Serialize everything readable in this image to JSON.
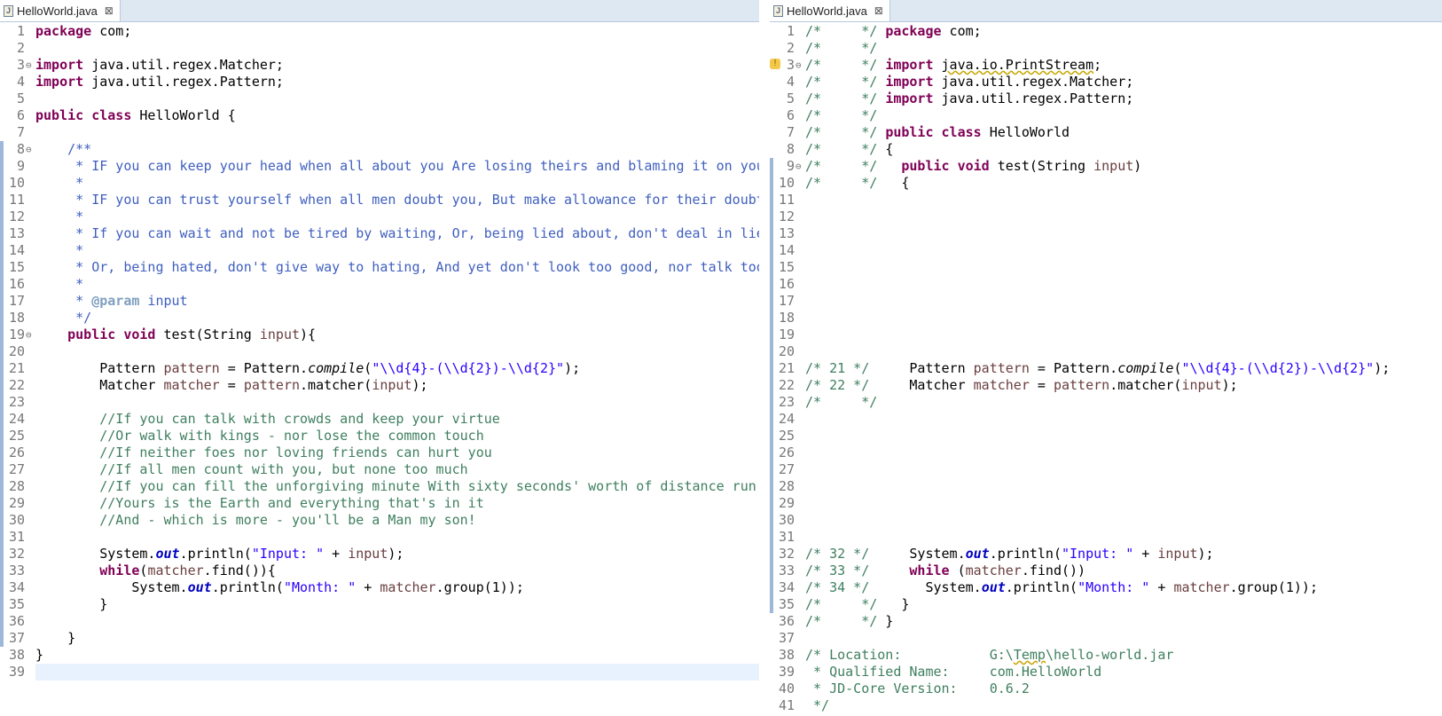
{
  "left": {
    "tab": {
      "label": "HelloWorld.java",
      "close_icon": "close-icon",
      "file_icon": "java-file-icon"
    },
    "lines": [
      {
        "n": "1",
        "html": "<span class=\"kw\">package</span> com;"
      },
      {
        "n": "2",
        "html": ""
      },
      {
        "n": "3",
        "fold": "⊖",
        "html": "<span class=\"kw\">import</span> java.util.regex.Matcher;"
      },
      {
        "n": "4",
        "html": "<span class=\"kw\">import</span> java.util.regex.Pattern;"
      },
      {
        "n": "5",
        "html": ""
      },
      {
        "n": "6",
        "html": "<span class=\"kw\">public</span> <span class=\"kw\">class</span> HelloWorld {"
      },
      {
        "n": "7",
        "html": ""
      },
      {
        "n": "8",
        "fold": "⊖",
        "marker": true,
        "html": "    <span class=\"jd\">/**</span>"
      },
      {
        "n": "9",
        "marker": true,
        "html": "<span class=\"jd\">     * IF you can keep your head when all about you Are losing theirs and blaming it on you</span>"
      },
      {
        "n": "10",
        "marker": true,
        "html": "<span class=\"jd\">     *</span>"
      },
      {
        "n": "11",
        "marker": true,
        "html": "<span class=\"jd\">     * IF you can trust yourself when all men doubt you, But make allowance for their doubting</span>"
      },
      {
        "n": "12",
        "marker": true,
        "html": "<span class=\"jd\">     *</span>"
      },
      {
        "n": "13",
        "marker": true,
        "html": "<span class=\"jd\">     * If you can wait and not be tired by waiting, Or, being lied about, don't deal in lies</span>"
      },
      {
        "n": "14",
        "marker": true,
        "html": "<span class=\"jd\">     *</span>"
      },
      {
        "n": "15",
        "marker": true,
        "html": "<span class=\"jd\">     * Or, being hated, don't give way to hating, And yet don't look too good, nor talk too wise</span>"
      },
      {
        "n": "16",
        "marker": true,
        "html": "<span class=\"jd\">     *</span>"
      },
      {
        "n": "17",
        "marker": true,
        "html": "<span class=\"jd\">     * </span><span class=\"jdtag\">@param</span><span class=\"jd\"> input</span>"
      },
      {
        "n": "18",
        "marker": true,
        "html": "<span class=\"jd\">     */</span>"
      },
      {
        "n": "19",
        "fold": "⊖",
        "marker": true,
        "html": "    <span class=\"kw\">public</span> <span class=\"kw\">void</span> test(String <span class=\"var\">input</span>){"
      },
      {
        "n": "20",
        "marker": true,
        "html": ""
      },
      {
        "n": "21",
        "marker": true,
        "html": "        Pattern <span class=\"var\">pattern</span> = Pattern.<span class=\"ital\">compile</span>(<span class=\"str\">\"\\\\d{4}-(\\\\d{2})-\\\\d{2}\"</span>);"
      },
      {
        "n": "22",
        "marker": true,
        "html": "        Matcher <span class=\"var\">matcher</span> = <span class=\"var\">pattern</span>.matcher(<span class=\"var\">input</span>);"
      },
      {
        "n": "23",
        "marker": true,
        "html": ""
      },
      {
        "n": "24",
        "marker": true,
        "html": "        <span class=\"cmt\">//If you can talk with crowds and keep your virtue</span>"
      },
      {
        "n": "25",
        "marker": true,
        "html": "        <span class=\"cmt\">//Or walk with kings - nor lose the common touch</span>"
      },
      {
        "n": "26",
        "marker": true,
        "html": "        <span class=\"cmt\">//If neither foes nor loving friends can hurt you</span>"
      },
      {
        "n": "27",
        "marker": true,
        "html": "        <span class=\"cmt\">//If all men count with you, but none too much</span>"
      },
      {
        "n": "28",
        "marker": true,
        "html": "        <span class=\"cmt\">//If you can fill the unforgiving minute With sixty seconds' worth of distance run</span>"
      },
      {
        "n": "29",
        "marker": true,
        "html": "        <span class=\"cmt\">//Yours is the Earth and everything that's in it</span>"
      },
      {
        "n": "30",
        "marker": true,
        "html": "        <span class=\"cmt\">//And - which is more - you'll be a Man my son!</span>"
      },
      {
        "n": "31",
        "marker": true,
        "html": ""
      },
      {
        "n": "32",
        "marker": true,
        "html": "        System.<span class=\"field\">out</span>.println(<span class=\"str\">\"Input: \"</span> + <span class=\"var\">input</span>);"
      },
      {
        "n": "33",
        "marker": true,
        "html": "        <span class=\"kw\">while</span>(<span class=\"var\">matcher</span>.find()){"
      },
      {
        "n": "34",
        "marker": true,
        "html": "            System.<span class=\"field\">out</span>.println(<span class=\"str\">\"Month: \"</span> + <span class=\"var\">matcher</span>.group(1));"
      },
      {
        "n": "35",
        "marker": true,
        "html": "        }"
      },
      {
        "n": "36",
        "marker": true,
        "html": ""
      },
      {
        "n": "37",
        "marker": true,
        "html": "    }"
      },
      {
        "n": "38",
        "html": "}"
      },
      {
        "n": "39",
        "current": true,
        "html": ""
      }
    ]
  },
  "right": {
    "tab": {
      "label": "HelloWorld.java",
      "close_icon": "close-icon",
      "file_icon": "java-file-icon"
    },
    "lines": [
      {
        "n": "1",
        "html": "<span class=\"bcmt\">/*     */</span> <span class=\"kw\">package</span> com;"
      },
      {
        "n": "2",
        "html": "<span class=\"bcmt\">/*     */</span>"
      },
      {
        "n": "3",
        "fold": "⊖",
        "warn": true,
        "html": "<span class=\"bcmt\">/*     */</span> <span class=\"kw\">import</span> <span class=\"squig\">java.io.PrintStream</span>;"
      },
      {
        "n": "4",
        "html": "<span class=\"bcmt\">/*     */</span> <span class=\"kw\">import</span> java.util.regex.Matcher;"
      },
      {
        "n": "5",
        "html": "<span class=\"bcmt\">/*     */</span> <span class=\"kw\">import</span> java.util.regex.Pattern;"
      },
      {
        "n": "6",
        "html": "<span class=\"bcmt\">/*     */</span>"
      },
      {
        "n": "7",
        "html": "<span class=\"bcmt\">/*     */</span> <span class=\"kw\">public</span> <span class=\"kw\">class</span> HelloWorld"
      },
      {
        "n": "8",
        "html": "<span class=\"bcmt\">/*     */</span> {"
      },
      {
        "n": "9",
        "fold": "⊖",
        "marker": true,
        "html": "<span class=\"bcmt\">/*     */</span>   <span class=\"kw\">public</span> <span class=\"kw\">void</span> test(String <span class=\"var\">input</span>)"
      },
      {
        "n": "10",
        "marker": true,
        "html": "<span class=\"bcmt\">/*     */</span>   {"
      },
      {
        "n": "11",
        "marker": true,
        "html": ""
      },
      {
        "n": "12",
        "marker": true,
        "html": ""
      },
      {
        "n": "13",
        "marker": true,
        "html": ""
      },
      {
        "n": "14",
        "marker": true,
        "html": ""
      },
      {
        "n": "15",
        "marker": true,
        "html": ""
      },
      {
        "n": "16",
        "marker": true,
        "html": ""
      },
      {
        "n": "17",
        "marker": true,
        "html": ""
      },
      {
        "n": "18",
        "marker": true,
        "html": ""
      },
      {
        "n": "19",
        "marker": true,
        "html": ""
      },
      {
        "n": "20",
        "marker": true,
        "html": ""
      },
      {
        "n": "21",
        "marker": true,
        "html": "<span class=\"bcmt\">/* 21 */</span>     Pattern <span class=\"var\">pattern</span> = Pattern.<span class=\"ital\">compile</span>(<span class=\"str\">\"\\\\d{4}-(\\\\d{2})-\\\\d{2}\"</span>);"
      },
      {
        "n": "22",
        "marker": true,
        "html": "<span class=\"bcmt\">/* 22 */</span>     Matcher <span class=\"var\">matcher</span> = <span class=\"var\">pattern</span>.matcher(<span class=\"var\">input</span>);"
      },
      {
        "n": "23",
        "marker": true,
        "html": "<span class=\"bcmt\">/*     */</span>"
      },
      {
        "n": "24",
        "marker": true,
        "html": ""
      },
      {
        "n": "25",
        "marker": true,
        "html": ""
      },
      {
        "n": "26",
        "marker": true,
        "html": ""
      },
      {
        "n": "27",
        "marker": true,
        "html": ""
      },
      {
        "n": "28",
        "marker": true,
        "html": ""
      },
      {
        "n": "29",
        "marker": true,
        "html": ""
      },
      {
        "n": "30",
        "marker": true,
        "html": ""
      },
      {
        "n": "31",
        "marker": true,
        "html": ""
      },
      {
        "n": "32",
        "marker": true,
        "html": "<span class=\"bcmt\">/* 32 */</span>     System.<span class=\"field\">out</span>.println(<span class=\"str\">\"Input: \"</span> + <span class=\"var\">input</span>);"
      },
      {
        "n": "33",
        "marker": true,
        "html": "<span class=\"bcmt\">/* 33 */</span>     <span class=\"kw\">while</span> (<span class=\"var\">matcher</span>.find())"
      },
      {
        "n": "34",
        "marker": true,
        "html": "<span class=\"bcmt\">/* 34 */</span>       System.<span class=\"field\">out</span>.println(<span class=\"str\">\"Month: \"</span> + <span class=\"var\">matcher</span>.group(1));"
      },
      {
        "n": "35",
        "marker": true,
        "html": "<span class=\"bcmt\">/*     */</span>   }"
      },
      {
        "n": "36",
        "html": "<span class=\"bcmt\">/*     */</span> }"
      },
      {
        "n": "37",
        "html": ""
      },
      {
        "n": "38",
        "html": "<span class=\"bcmt\">/* Location:           G:\\<span class=\"squig\">Temp</span>\\hello-world.jar</span>"
      },
      {
        "n": "39",
        "html": "<span class=\"bcmt\"> * Qualified Name:     com.HelloWorld</span>"
      },
      {
        "n": "40",
        "html": "<span class=\"bcmt\"> * JD-Core Version:    0.6.2</span>"
      },
      {
        "n": "41",
        "html": "<span class=\"bcmt\"> */</span>"
      }
    ]
  }
}
